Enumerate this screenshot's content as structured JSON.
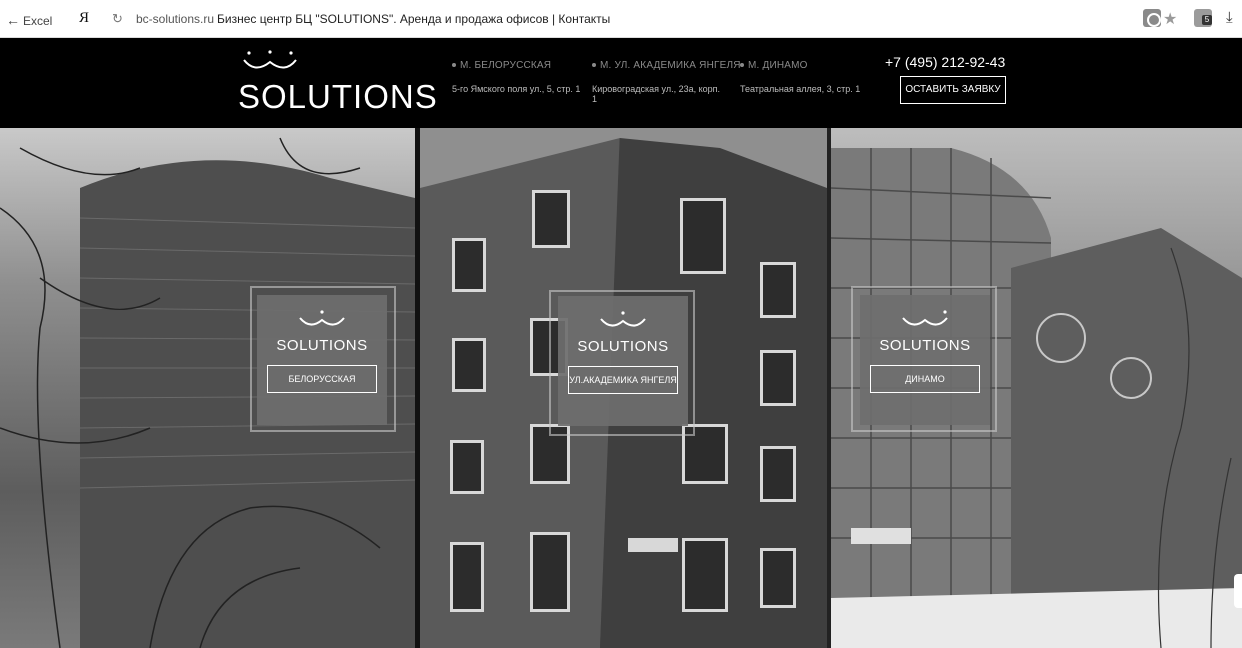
{
  "browser": {
    "back_label": "Excel",
    "yandex_logo": "Я",
    "url": "bc-solutions.ru",
    "page_title": "Бизнес центр БЦ \"SOLUTIONS\". Аренда и продажа офисов | Контакты"
  },
  "header": {
    "logo_text": "SOLUTIONS",
    "locations": [
      {
        "metro": "М. БЕЛОРУССКАЯ",
        "address": "5-го Ямского поля ул., 5, стр. 1"
      },
      {
        "metro": "М. УЛ. АКАДЕМИКА ЯНГЕЛЯ",
        "address": "Кировоградская ул., 23а, корп. 1"
      },
      {
        "metro": "М. ДИНАМО",
        "address": "Театральная аллея, 3, стр. 1"
      }
    ],
    "phone": "+7 (495) 212-92-43",
    "request_button": "ОСТАВИТЬ ЗАЯВКУ"
  },
  "cards": [
    {
      "name": "SOLUTIONS",
      "button": "БЕЛОРУССКАЯ"
    },
    {
      "name": "SOLUTIONS",
      "button": "УЛ.АКАДЕМИКА ЯНГЕЛЯ"
    },
    {
      "name": "SOLUTIONS",
      "button": "ДИНАМО"
    }
  ],
  "colors": {
    "header_bg": "#000000",
    "card_bg": "#6e6e6e",
    "text": "#ffffff"
  }
}
